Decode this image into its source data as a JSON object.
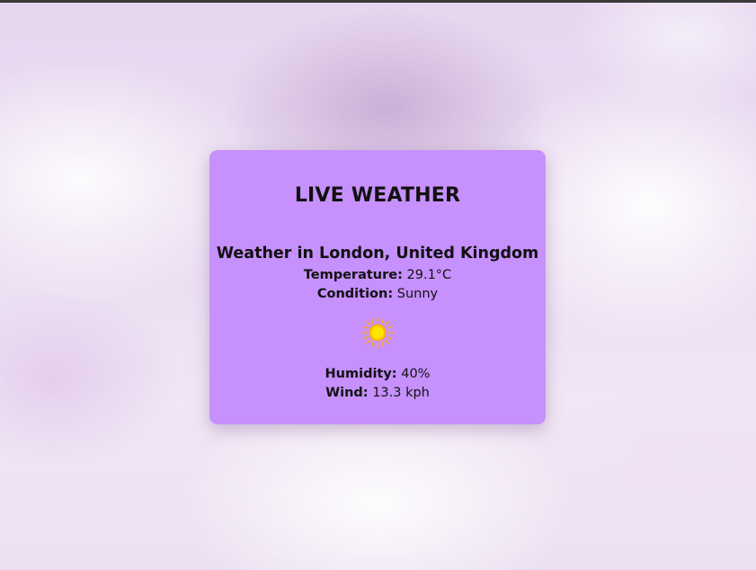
{
  "app": {
    "title": "LIVE WEATHER"
  },
  "weather": {
    "heading": "Weather in London, United Kingdom",
    "temperature_label": "Temperature:",
    "temperature_value": "29.1°C",
    "condition_label": "Condition:",
    "condition_value": "Sunny",
    "condition_icon": "sun-icon",
    "humidity_label": "Humidity:",
    "humidity_value": "40%",
    "wind_label": "Wind:",
    "wind_value": "13.3 kph"
  },
  "colors": {
    "card_background": "#c690fd",
    "sun_core": "#ffe600",
    "sun_rays": "#ffa726"
  }
}
